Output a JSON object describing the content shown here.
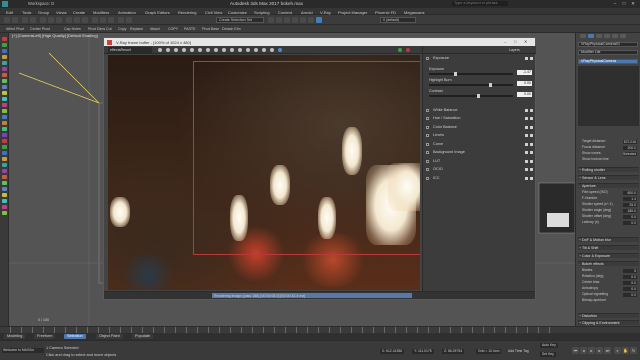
{
  "app": {
    "title": "Autodesk 3ds Max 2017    bokeh.max",
    "workspace": "Workspace: D",
    "search_placeholder": "Type a keyword or phrase"
  },
  "menu": [
    "Edit",
    "Tools",
    "Group",
    "Views",
    "Create",
    "Modifiers",
    "Animation",
    "Graph Editors",
    "Rendering",
    "Civil View",
    "Customize",
    "Scripting",
    "Content",
    "Arnold",
    "V-Ray",
    "Project Manager",
    "Phoenix FD",
    "Megascans"
  ],
  "toolbar": {
    "selection_set": "Create Selection Set",
    "layer": "0 (default)"
  },
  "toolbar2": [
    "Affect Pivot",
    "Center Pivot",
    "Cap Holes",
    "Pivot Dims",
    "Cut",
    "Copy",
    "Replace",
    "Attach",
    "COPY",
    "PASTE",
    "Pivot Base",
    "Detach Elm"
  ],
  "viewport": {
    "label": "[+] [CameraLeft] [High Quality] [Default Shading]"
  },
  "vfb": {
    "title": "V-Ray frame buffer - [100% of 1024 x 480]",
    "channel": "effectsResult",
    "status": "Rendering image (pass 186) [00:00:05.0] [00:00:33.4 est]"
  },
  "layers": {
    "items": [
      {
        "name": "Exposure",
        "expanded": true
      },
      {
        "name": "White Balance"
      },
      {
        "name": "Hue / Saturation"
      },
      {
        "name": "Color Balance"
      },
      {
        "name": "Levels"
      },
      {
        "name": "Curve"
      },
      {
        "name": "Background Image"
      },
      {
        "name": "LUT"
      },
      {
        "name": "OCIO"
      },
      {
        "name": "ICC"
      }
    ],
    "exposure_label": "Exposure",
    "exposure_value": "-1.47",
    "highlight_label": "Highlight Burn",
    "highlight_value": "0.00",
    "contrast_label": "Contrast",
    "contrast_value": "0.00",
    "header_btn": "Layers"
  },
  "cmdpanel": {
    "object_name": "VRayPhysicalCamera01",
    "modifier_list": "Modifier List",
    "modifier_item": "VRayPhysicalCamera",
    "fields": [
      {
        "label": "Target distance:",
        "value": "872.016"
      },
      {
        "label": "Focus distance:",
        "value": "200.0"
      },
      {
        "label": "Show cones:",
        "value": "Selected"
      }
    ],
    "show_horizon": "Show horizon line",
    "sections": [
      {
        "name": "Rolling shutter",
        "sign": "+"
      },
      {
        "name": "Sensor & Lens",
        "sign": "+"
      },
      {
        "name": "Aperture",
        "sign": "-"
      }
    ],
    "aperture_rows": [
      {
        "label": "Film speed (ISO)",
        "value": "600.0"
      },
      {
        "label": "F-Number",
        "value": "1.4"
      },
      {
        "label": "Shutter speed (s^-1)",
        "value": "25.0"
      },
      {
        "label": "Shutter angle (deg)",
        "value": "180.0"
      },
      {
        "label": "Shutter offset (deg)",
        "value": "0.0"
      },
      {
        "label": "Latency (s)",
        "value": "0.0"
      }
    ],
    "sections2": [
      {
        "name": "DoF & Motion blur",
        "sign": "+"
      },
      {
        "name": "Tilt & Shift",
        "sign": "+"
      },
      {
        "name": "Color & Exposure",
        "sign": "+"
      },
      {
        "name": "Bokeh effects",
        "sign": "-"
      }
    ],
    "bokeh_rows": [
      {
        "label": "Blades",
        "value": "5"
      },
      {
        "label": "Rotation (deg)",
        "value": "0.0"
      },
      {
        "label": "Center bias",
        "value": "0.0"
      },
      {
        "label": "Anisotropy",
        "value": "0.0"
      },
      {
        "label": "Optical vignetting",
        "value": "0.0"
      }
    ],
    "bitmap_aperture": "Bitmap aperture",
    "sections3": [
      {
        "name": "Distortion",
        "sign": "+"
      },
      {
        "name": "Clipping & Environment",
        "sign": "+"
      }
    ]
  },
  "timeline": {
    "frame": "0 / 100"
  },
  "scenetabs": [
    "Modeling",
    "Freeform",
    "Selection",
    "Object Paint",
    "Populate"
  ],
  "status": {
    "maxscript": "Welcome to MAXScr",
    "selected": "1 Camera Selected",
    "hint": "Click and drag to select and move objects",
    "x": "X: 612.41356",
    "y": "Y: 111.0175",
    "z": "Z: 86.25754",
    "grid": "Grid = 10.0cm",
    "add_tag": "Add Time Tag",
    "autokey": "Auto Key",
    "setkey": "Set Key"
  }
}
